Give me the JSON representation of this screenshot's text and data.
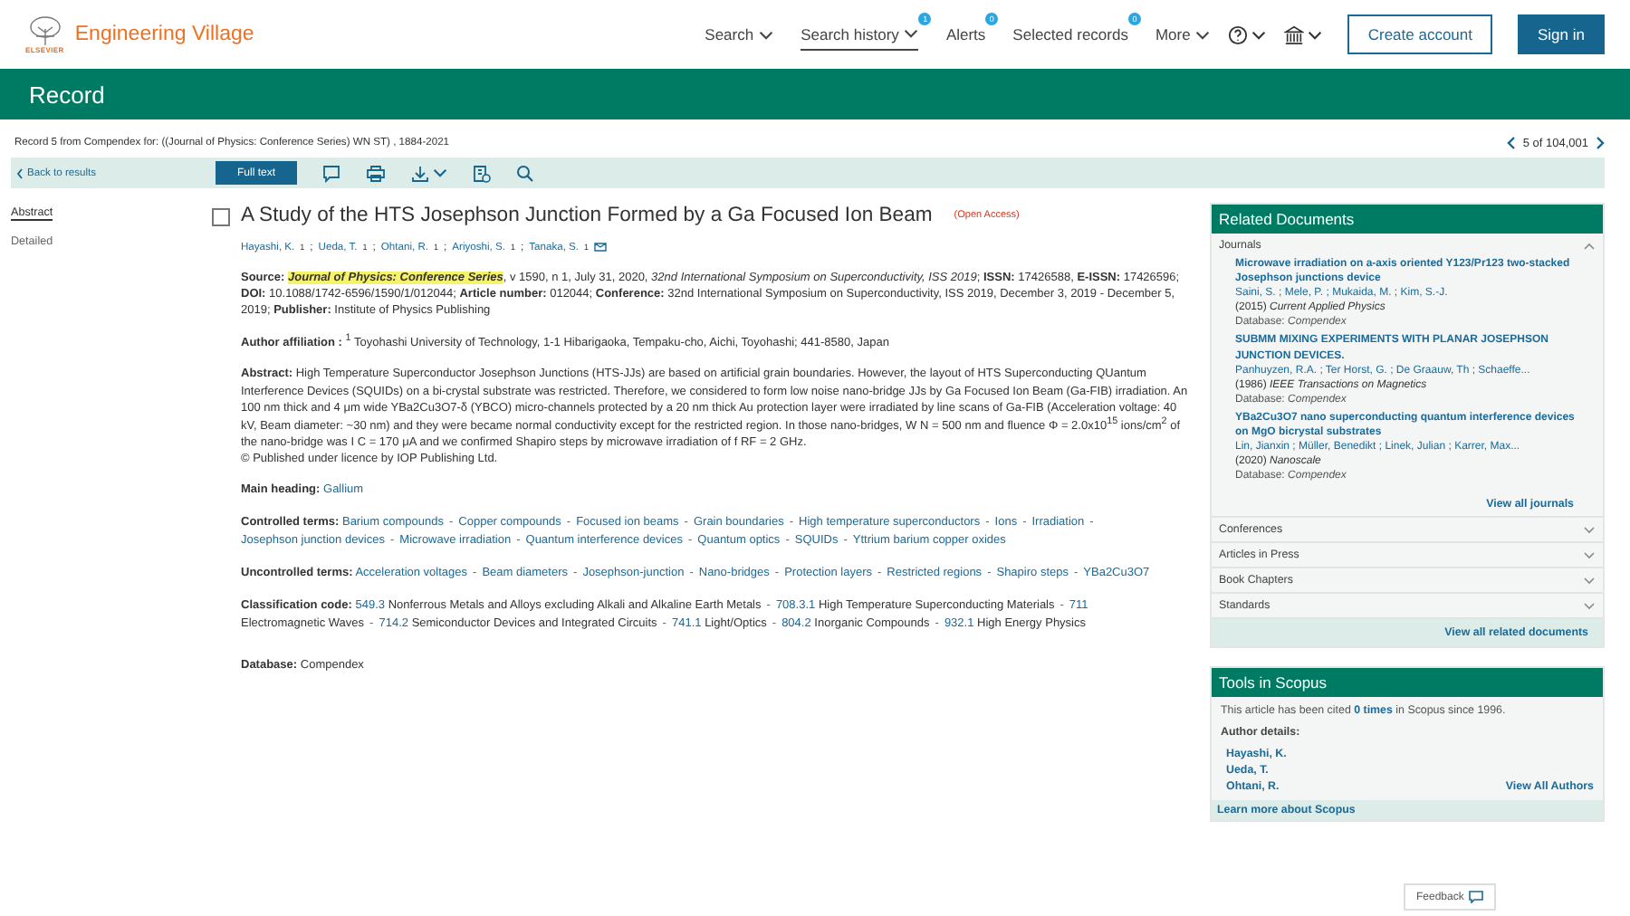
{
  "header": {
    "publisher": "ELSEVIER",
    "product": "Engineering Village",
    "nav": [
      {
        "label": "Search",
        "kind": "menu",
        "selected": false
      },
      {
        "label": "Search history",
        "kind": "menu",
        "selected": true,
        "badge": "1"
      },
      {
        "label": "Alerts",
        "kind": "link",
        "selected": false,
        "badge": "0"
      },
      {
        "label": "Selected records",
        "kind": "link",
        "selected": false,
        "badge": "0"
      },
      {
        "label": "More",
        "kind": "menu",
        "selected": false
      }
    ],
    "create_account": "Create account",
    "sign_in": "Sign in"
  },
  "page_title": "Record",
  "record_info": "Record 5 from Compendex for: ((Journal of Physics: Conference Series) WN ST) , 1884-2021",
  "pager": "5 of 104,001",
  "toolbar": {
    "back": "Back to results",
    "full_text": "Full text"
  },
  "view_tabs": [
    {
      "label": "Abstract",
      "selected": true
    },
    {
      "label": "Detailed",
      "selected": false
    }
  ],
  "record": {
    "checked": false,
    "title": "A Study of the HTS Josephson Junction Formed by a Ga Focused Ion Beam",
    "access": "(Open Access)",
    "authors": [
      {
        "name": "Hayashi, K.",
        "sup": "1",
        "sep": ";"
      },
      {
        "name": "Ueda, T.",
        "sup": "1",
        "sep": ";"
      },
      {
        "name": "Ohtani, R.",
        "sup": "1",
        "sep": ";"
      },
      {
        "name": "Ariyoshi, S.",
        "sup": "1",
        "sep": ";"
      },
      {
        "name": "Tanaka, S.",
        "sup": "1"
      }
    ],
    "source": {
      "label": "Source:",
      "journal": "Journal of Physics: Conference Series",
      "text": ", v 1590, n 1, July 31, 2020, *32nd International Symposium on Superconductivity, ISS 2019*;  **ISSN:** 17426588,  **E-ISSN:** 17426596;  **DOI:** 10.1088/1742-6596/1590/1/012044;  **Article number:** 012044; **Conference:** 32nd International Symposium on Superconductivity, ISS 2019, December 3, 2019 - December 5, 2019; **Publisher:** Institute of Physics Publishing"
    },
    "affiliation": "**Author affiliation :** $^{1}$ Toyohashi University of Technology, 1-1 Hibarigaoka, Tempaku-cho, Aichi, Toyohashi; 441-8580, Japan",
    "abstract": "**Abstract:** High Temperature Superconductor Josephson Junctions (HTS-JJs) are based on artificial grain boundaries. However, the layout of HTS Superconducting QUantum Interference Devices (SQUIDs) on a bi-crystal substrate was restricted. Therefore, we considered to form low noise nano-bridge JJs by Ga Focused Ion Beam (Ga-FIB) irradiation. An 100 nm thick and 4 μm wide YBa2Cu3O7-δ (YBCO) micro-channels protected by a 20 nm thick Au protection layer were irradiated by line scans of Ga-FIB (Acceleration voltage: 40 kV, Beam diameter: ~30 nm) and they were became normal conductivity except for the restricted region. In those nano-bridges, W N = 500 nm and fluence Φ = 2.0x10$^{15}$ ions/cm$^{2}$ of the nano-bridge was I C = 170 μA and we confirmed Shapiro steps by microwave irradiation of f RF = 2 GHz.",
    "copyright": "© Published under licence by IOP Publishing Ltd.",
    "term_groups": [
      {
        "label": "Main heading:",
        "terms": [
          "Gallium"
        ]
      },
      {
        "label": "Controlled terms:",
        "separator": "-",
        "terms": [
          "Barium compounds",
          "Copper compounds",
          "Focused ion beams",
          "Grain boundaries",
          "High temperature superconductors",
          "Ions",
          "Irradiation",
          "Josephson junction devices",
          "Microwave irradiation",
          "Quantum interference devices",
          "Quantum optics",
          "SQUIDs",
          "Yttrium barium copper oxides"
        ]
      },
      {
        "label": "Uncontrolled terms:",
        "separator": "-",
        "terms": [
          "Acceleration voltages",
          "Beam diameters",
          "Josephson-junction",
          "Nano-bridges",
          "Protection layers",
          "Restricted regions",
          "Shapiro steps",
          "YBa2Cu3O7"
        ]
      }
    ],
    "classification": {
      "label": "Classification code:",
      "separator": "-",
      "codes": [
        {
          "code": "549.3",
          "text": "Nonferrous Metals and Alloys excluding Alkali and Alkaline Earth Metals"
        },
        {
          "code": "708.3.1",
          "text": "High Temperature Superconducting Materials"
        },
        {
          "code": "711",
          "text": "Electromagnetic Waves"
        },
        {
          "code": "714.2",
          "text": "Semiconductor Devices and Integrated Circuits"
        },
        {
          "code": "741.1",
          "text": "Light/Optics"
        },
        {
          "code": "804.2",
          "text": "Inorganic Compounds"
        },
        {
          "code": "932.1",
          "text": "High Energy Physics"
        }
      ]
    },
    "database": "**Database:** Compendex"
  },
  "related": {
    "title": "Related Documents",
    "sections": [
      {
        "label": "Journals",
        "expanded": true,
        "items": [
          {
            "title": "Microwave irradiation on a-axis oriented Y123/Pr123 two-stacked Josephson junctions device",
            "authors": "Saini, S. ; Mele, P. ; Mukaida, M. ; Kim, S.-J.",
            "source": "(2015) *Current Applied Physics*",
            "database": "Database: *Compendex*"
          },
          {
            "title": "SUBMM MIXING EXPERIMENTS WITH PLANAR JOSEPHSON JUNCTION DEVICES.",
            "authors": "Panhuyzen, R.A. ; Ter Horst, G. ; De Graauw, Th ; Schaeffe...",
            "source": "(1986) *IEEE Transactions on Magnetics*",
            "database": "Database: *Compendex*"
          },
          {
            "title": "YBa2Cu3O7 nano superconducting quantum interference devices on MgO bicrystal substrates",
            "authors": "Lin, Jianxin ; Müller, Benedikt ; Linek, Julian ; Karrer, Max...",
            "source": "(2020) *Nanoscale*",
            "database": "Database: *Compendex*"
          }
        ],
        "view_all": "View all journals"
      },
      {
        "label": "Conferences",
        "expanded": false
      },
      {
        "label": "Articles in Press",
        "expanded": false
      },
      {
        "label": "Book Chapters",
        "expanded": false
      },
      {
        "label": "Standards",
        "expanded": false
      }
    ],
    "view_all": "View all related documents"
  },
  "scopus": {
    "title": "Tools in Scopus",
    "cited": "This article has been cited **0 times** in Scopus since 1996.",
    "author_details": "Author details:",
    "authors": [
      "Hayashi, K.",
      "Ueda, T.",
      "Ohtani, R."
    ],
    "view_all": "View All Authors",
    "learn_more": "Learn more about Scopus"
  },
  "feedback": "Feedback"
}
